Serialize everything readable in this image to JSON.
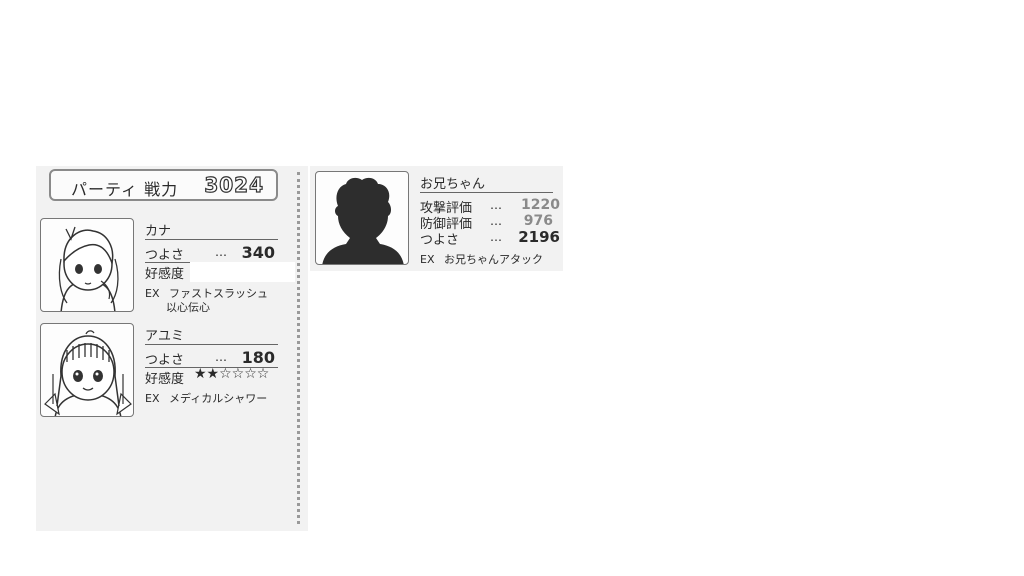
{
  "party": {
    "label": "パーティ 戦力",
    "power": "3024"
  },
  "characters": [
    {
      "name": "カナ",
      "stat_label": "つよさ",
      "dots": "…",
      "stat_value": "340",
      "affinity_label": "好感度",
      "affinity_stars": "",
      "ex_prefix": "EX",
      "ex_line1": "ファストスラッシュ",
      "ex_line2": "以心伝心"
    },
    {
      "name": "アユミ",
      "stat_label": "つよさ",
      "dots": "…",
      "stat_value": "180",
      "affinity_label": "好感度",
      "affinity_stars": "★★☆☆☆☆",
      "ex_prefix": "EX",
      "ex_line1": "メディカルシャワー"
    }
  ],
  "hero": {
    "name": "お兄ちゃん",
    "rows": [
      {
        "label": "攻撃評価",
        "dots": "…",
        "value": "1220"
      },
      {
        "label": "防御評価",
        "dots": "…",
        "value": "976"
      },
      {
        "label": "つよさ",
        "dots": "…",
        "value": "2196"
      }
    ],
    "ex_prefix": "EX",
    "ex_skill": "お兄ちゃんアタック"
  },
  "icons": [
    "kana-portrait",
    "ayumi-portrait",
    "hero-silhouette"
  ]
}
